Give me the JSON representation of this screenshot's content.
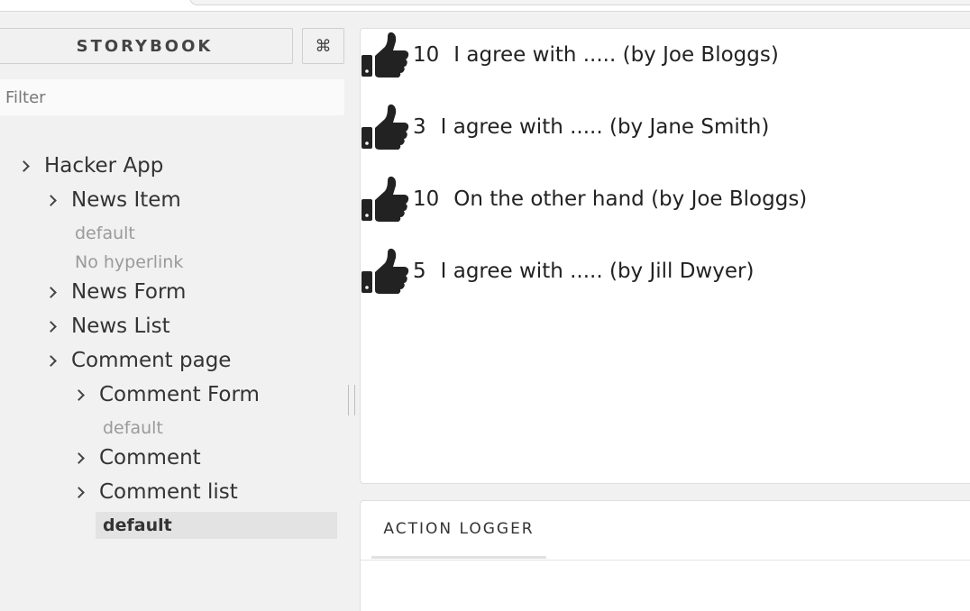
{
  "sidebar": {
    "brand": "STORYBOOK",
    "shortcut_icon": "command-icon",
    "shortcut_glyph": "⌘",
    "filter_placeholder": "Filter",
    "tree": {
      "hacker_app": "Hacker App",
      "news_item": "News Item",
      "news_item_stories": [
        "default",
        "No hyperlink"
      ],
      "news_form": "News Form",
      "news_list": "News List",
      "comment_page": "Comment page",
      "comment_form": "Comment Form",
      "comment_form_stories": [
        "default"
      ],
      "comment": "Comment",
      "comment_list": "Comment list",
      "comment_list_stories": [
        "default"
      ]
    },
    "selected_story": "default"
  },
  "preview": {
    "upvote_icon": "thumbs-up-icon",
    "comments": [
      {
        "score": "10",
        "text": "I agree with ..... (by Joe Bloggs)"
      },
      {
        "score": "3",
        "text": "I agree with ..... (by Jane Smith)"
      },
      {
        "score": "10",
        "text": "On the other hand (by Joe Bloggs)"
      },
      {
        "score": "5",
        "text": "I agree with ..... (by Jill Dwyer)"
      }
    ]
  },
  "addons": {
    "tabs": [
      "ACTION LOGGER"
    ]
  },
  "colors": {
    "sidebar_bg": "#f1f1f1",
    "selected_bg": "#e3e3e3",
    "story_text": "#9a9a9a",
    "icon": "#222222"
  }
}
